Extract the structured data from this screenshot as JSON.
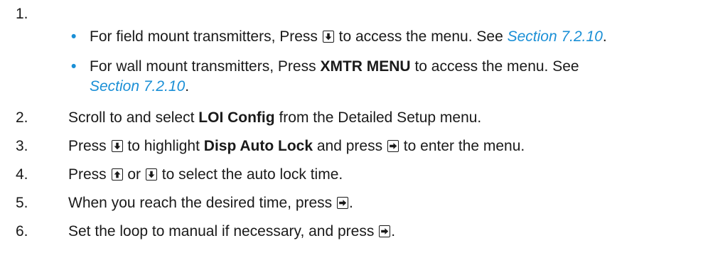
{
  "steps": [
    {
      "number": "1.",
      "bullets": [
        {
          "pre": "For field mount transmitters, Press",
          "post": "to access the menu. See",
          "link": "Section 7.2.10",
          "end": "."
        },
        {
          "pre": "For wall mount transmitters, Press",
          "bold": "XMTR MENU",
          "post": "to access the menu. See",
          "link": "Section 7.2.10",
          "end": "."
        }
      ]
    },
    {
      "number": "2.",
      "pre": "Scroll to and select",
      "bold": "LOI Config",
      "post": "from the Detailed Setup menu."
    },
    {
      "number": "3.",
      "pre": "Press",
      "mid": "to highlight",
      "bold": "Disp Auto Lock",
      "mid2": "and press",
      "post": "to enter the menu."
    },
    {
      "number": "4.",
      "pre": "Press",
      "mid": "or",
      "post": "to select the auto lock time."
    },
    {
      "number": "5.",
      "pre": "When you reach the desired time, press",
      "end": "."
    },
    {
      "number": "6.",
      "pre": "Set the loop to manual if necessary, and press",
      "end": "."
    }
  ],
  "icons": {
    "down": "down-arrow-key-icon",
    "up": "up-arrow-key-icon",
    "right": "right-arrow-key-icon"
  }
}
